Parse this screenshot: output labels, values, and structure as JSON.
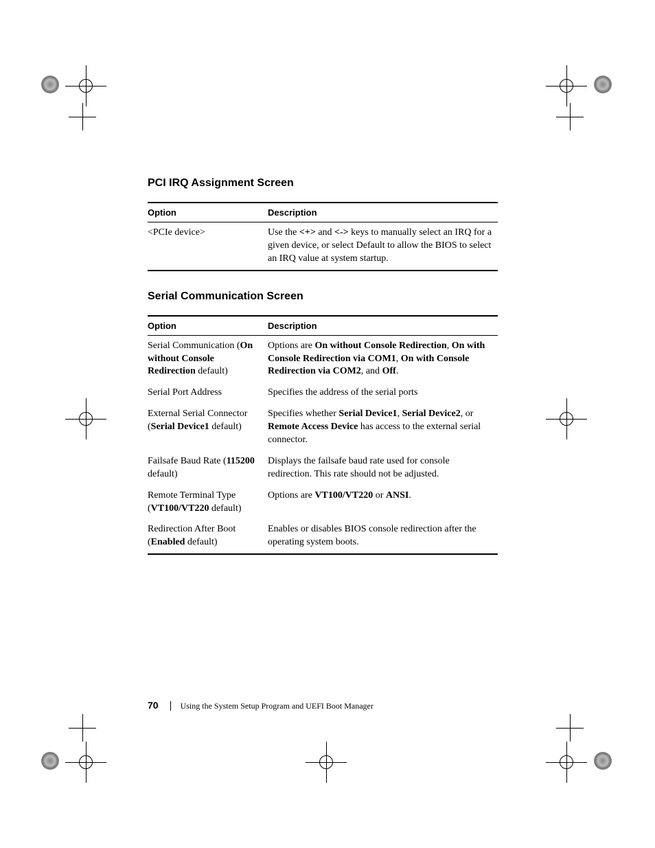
{
  "section1": {
    "heading": "PCI IRQ Assignment Screen",
    "headers": {
      "option": "Option",
      "description": "Description"
    },
    "rows": [
      {
        "option": "<PCIe device>",
        "desc_p1": "Use the ",
        "desc_b1": "<+>",
        "desc_p2": " and ",
        "desc_b2": "<->",
        "desc_p3": " keys to manually select an IRQ for a given device, or select Default to allow the BIOS to select an IRQ value at system startup."
      }
    ]
  },
  "section2": {
    "heading": "Serial Communication Screen",
    "headers": {
      "option": "Option",
      "description": "Description"
    },
    "rows": [
      {
        "opt_p1": "Serial Communication (",
        "opt_b1": "On without Console Redirection",
        "opt_p2": " default)",
        "desc_p1": "Options are ",
        "desc_b1": "On without Console Redirection",
        "desc_p2": ", ",
        "desc_b2": "On with Console Redirection via COM1",
        "desc_p3": ", ",
        "desc_b3": "On with Console Redirection via COM2",
        "desc_p4": ", and ",
        "desc_b4": "Off",
        "desc_p5": "."
      },
      {
        "opt_p1": "Serial Port Address",
        "opt_b1": "",
        "opt_p2": "",
        "desc_p1": "Specifies the address of the serial ports",
        "desc_b1": "",
        "desc_p2": "",
        "desc_b2": "",
        "desc_p3": "",
        "desc_b3": "",
        "desc_p4": "",
        "desc_b4": "",
        "desc_p5": ""
      },
      {
        "opt_p1": "External Serial Connector (",
        "opt_b1": "Serial Device1",
        "opt_p2": " default)",
        "desc_p1": "Specifies whether ",
        "desc_b1": "Serial Device1",
        "desc_p2": ", ",
        "desc_b2": "Serial Device2",
        "desc_p3": ", or ",
        "desc_b3": "Remote Access Device",
        "desc_p4": " has access to the external serial connector.",
        "desc_b4": "",
        "desc_p5": ""
      },
      {
        "opt_p1": "Failsafe Baud Rate (",
        "opt_b1": "115200",
        "opt_p2": " default)",
        "desc_p1": "Displays the failsafe baud rate used for console redirection. This rate should not be adjusted.",
        "desc_b1": "",
        "desc_p2": "",
        "desc_b2": "",
        "desc_p3": "",
        "desc_b3": "",
        "desc_p4": "",
        "desc_b4": "",
        "desc_p5": ""
      },
      {
        "opt_p1": "Remote Terminal Type (",
        "opt_b1": "VT100/VT220",
        "opt_p2": " default)",
        "desc_p1": "Options are ",
        "desc_b1": "VT100/VT220",
        "desc_p2": " or ",
        "desc_b2": "ANSI",
        "desc_p3": ".",
        "desc_b3": "",
        "desc_p4": "",
        "desc_b4": "",
        "desc_p5": ""
      },
      {
        "opt_p1": "Redirection After Boot (",
        "opt_b1": "Enabled",
        "opt_p2": " default)",
        "desc_p1": "Enables or disables BIOS console redirection after the operating system boots.",
        "desc_b1": "",
        "desc_p2": "",
        "desc_b2": "",
        "desc_p3": "",
        "desc_b3": "",
        "desc_p4": "",
        "desc_b4": "",
        "desc_p5": ""
      }
    ]
  },
  "footer": {
    "page": "70",
    "chapter": "Using the System Setup Program and UEFI Boot Manager"
  }
}
